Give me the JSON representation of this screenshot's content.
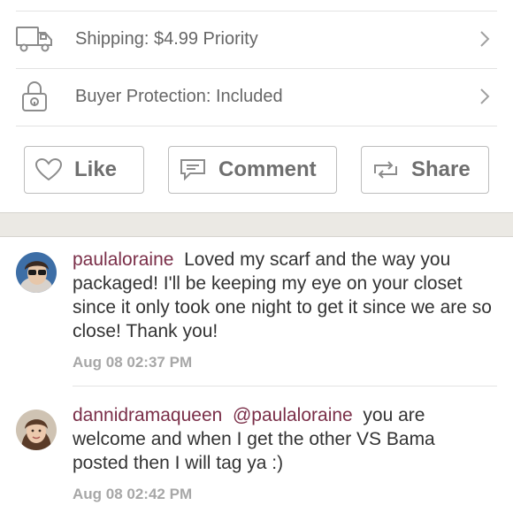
{
  "listing": {
    "shipping_label": "Shipping: $4.99 Priority",
    "protection_label": "Buyer Protection: Included"
  },
  "actions": {
    "like_label": "Like",
    "comment_label": "Comment",
    "share_label": "Share"
  },
  "comments": [
    {
      "username": "paulaloraine",
      "text": "Loved my scarf and the way you packaged! I'll be keeping my eye on your closet since it only took one night to get it since we are so close! Thank you!",
      "timestamp": "Aug 08 02:37 PM"
    },
    {
      "username": "dannidramaqueen",
      "mention": "@paulaloraine",
      "text": "you are welcome and when I get the other VS Bama posted then I will tag ya :)",
      "timestamp": "Aug 08 02:42 PM"
    }
  ],
  "colors": {
    "username": "#7a2e48",
    "timestamp": "#a7a7a7",
    "band": "#ebe9e4"
  },
  "icons": {
    "shipping": "truck-icon",
    "protection": "padlock-icon",
    "row_arrow": "chevron-right-icon",
    "like": "heart-icon",
    "comment": "speech-bubble-icon",
    "share": "repost-icon"
  }
}
